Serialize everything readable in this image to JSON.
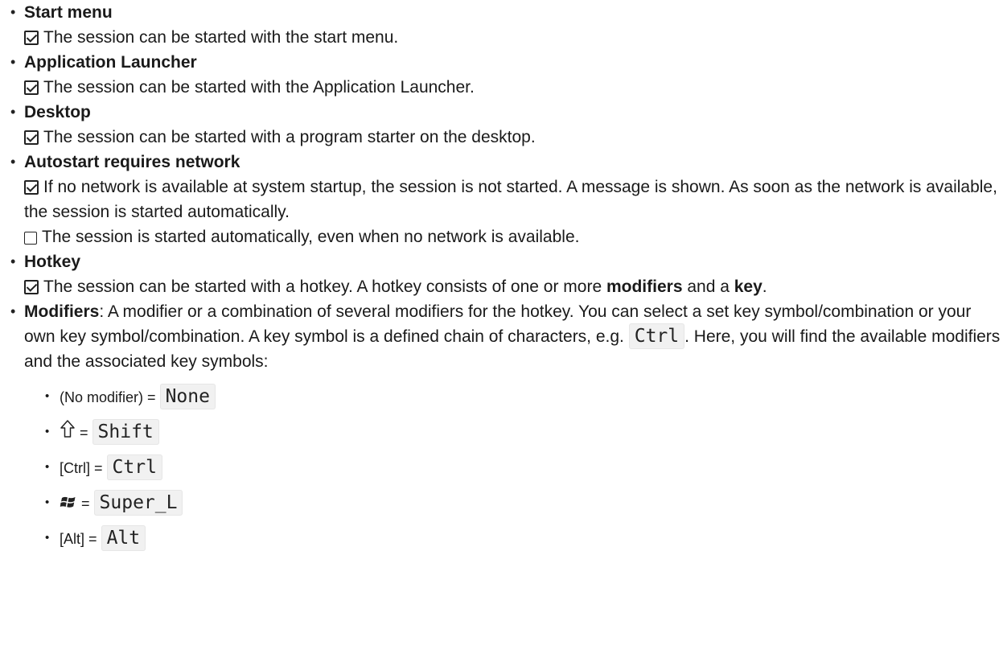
{
  "items": [
    {
      "title": "Start menu",
      "checked_text": "The session can be started with the start menu."
    },
    {
      "title": "Application Launcher",
      "checked_text": "The session can be started with the Application Launcher."
    },
    {
      "title": "Desktop",
      "checked_text": "The session can be started with a program starter on the desktop."
    },
    {
      "title": "Autostart requires network",
      "checked_text": "If no network is available at system startup, the session is not started. A message is shown. As soon as the network is available, the session is started automatically.",
      "unchecked_text": "The session is started automatically, even when no network is available."
    },
    {
      "title": "Hotkey",
      "checked_text_a": "The session can be started with a hotkey. A hotkey consists of one or more ",
      "checked_bold_1": "modifiers",
      "checked_text_b": " and a ",
      "checked_bold_2": "key",
      "checked_text_c": "."
    }
  ],
  "modifiers": {
    "label": "Modifiers",
    "text_a": ": A modifier or a combination of several modifiers for the hotkey. You can select a set key symbol/combination or your own key symbol/combination. A key symbol is a defined chain of characters, e.g. ",
    "example_code": "Ctrl",
    "text_b": ". Here, you will find the available modifiers and the associated key symbols:",
    "list": [
      {
        "label": "(No modifier)",
        "icon": "",
        "equals": "=",
        "code": "None"
      },
      {
        "label": "",
        "icon": "shift-arrow-icon",
        "equals": "=",
        "code": "Shift"
      },
      {
        "label": "[Ctrl]",
        "icon": "",
        "equals": "=",
        "code": "Ctrl"
      },
      {
        "label": "",
        "icon": "windows-logo-icon",
        "equals": "=",
        "code": "Super_L"
      },
      {
        "label": "[Alt]",
        "icon": "",
        "equals": "=",
        "code": "Alt"
      }
    ]
  }
}
